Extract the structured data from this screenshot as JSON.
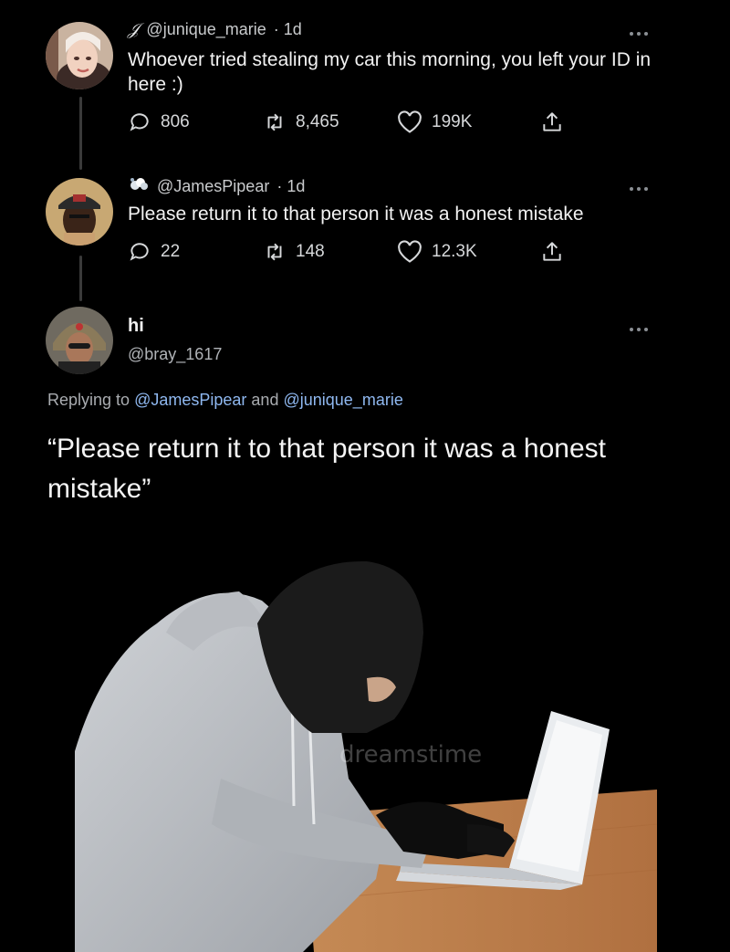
{
  "tweet1": {
    "handle": "@junique_marie",
    "time": "· 1d",
    "name_glyph": "𝒥",
    "text": "Whoever tried stealing my car this morning, you left your ID in here :)",
    "replies": "806",
    "retweets": "8,465",
    "likes": "199K"
  },
  "tweet2": {
    "handle": "@JamesPipear",
    "time": "· 1d",
    "text": "Please return it to that person it was a honest mistake",
    "replies": "22",
    "retweets": "148",
    "likes": "12.3K"
  },
  "tweet3": {
    "name": "hi",
    "handle": "@bray_1617",
    "replying_prefix": "Replying to",
    "mention1": "@JamesPipear",
    "and": "and",
    "mention2": "@junique_marie",
    "text": "“Please return it to that person it was a honest mistake”"
  },
  "photo": {
    "watermark": "dreamstime"
  },
  "icons": {
    "reply": "reply-icon",
    "retweet": "retweet-icon",
    "like": "heart-icon",
    "share": "share-icon",
    "more": "more-icon"
  }
}
